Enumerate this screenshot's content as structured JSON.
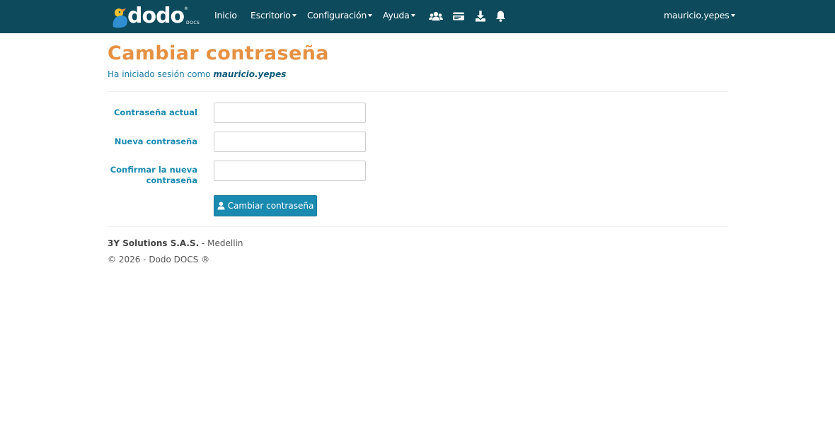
{
  "navbar": {
    "brand": {
      "word": "dodo",
      "sub": "DOCS",
      "reg": "®"
    },
    "menu": [
      {
        "label": "Inicio",
        "has_caret": false
      },
      {
        "label": "Escritorio",
        "has_caret": true
      },
      {
        "label": "Configuración",
        "has_caret": true
      },
      {
        "label": "Ayuda",
        "has_caret": true
      }
    ],
    "icons": [
      "users-icon",
      "card-icon",
      "download-icon",
      "bell-icon"
    ],
    "user_menu": "mauricio.yepes"
  },
  "main": {
    "title": "Cambiar contraseña",
    "subtitle_prefix": "Ha iniciado sesión como",
    "subtitle_user": "mauricio.yepes",
    "form": {
      "fields": [
        {
          "label": "Contraseña actual",
          "value": ""
        },
        {
          "label": "Nueva contraseña",
          "value": ""
        },
        {
          "label_line1": "Confirmar la nueva",
          "label_line2": "contraseña",
          "value": ""
        }
      ],
      "submit_label": "Cambiar contraseña",
      "submit_icon": "user-icon"
    }
  },
  "footer": {
    "company": "3Y Solutions S.A.S.",
    "separator": " - ",
    "city": "Medellin",
    "copyright": "© 2026 - Dodo DOCS ®"
  },
  "colors": {
    "navbar_bg": "#0d4a5c",
    "title": "#e59144",
    "accent": "#1a8ab0"
  }
}
